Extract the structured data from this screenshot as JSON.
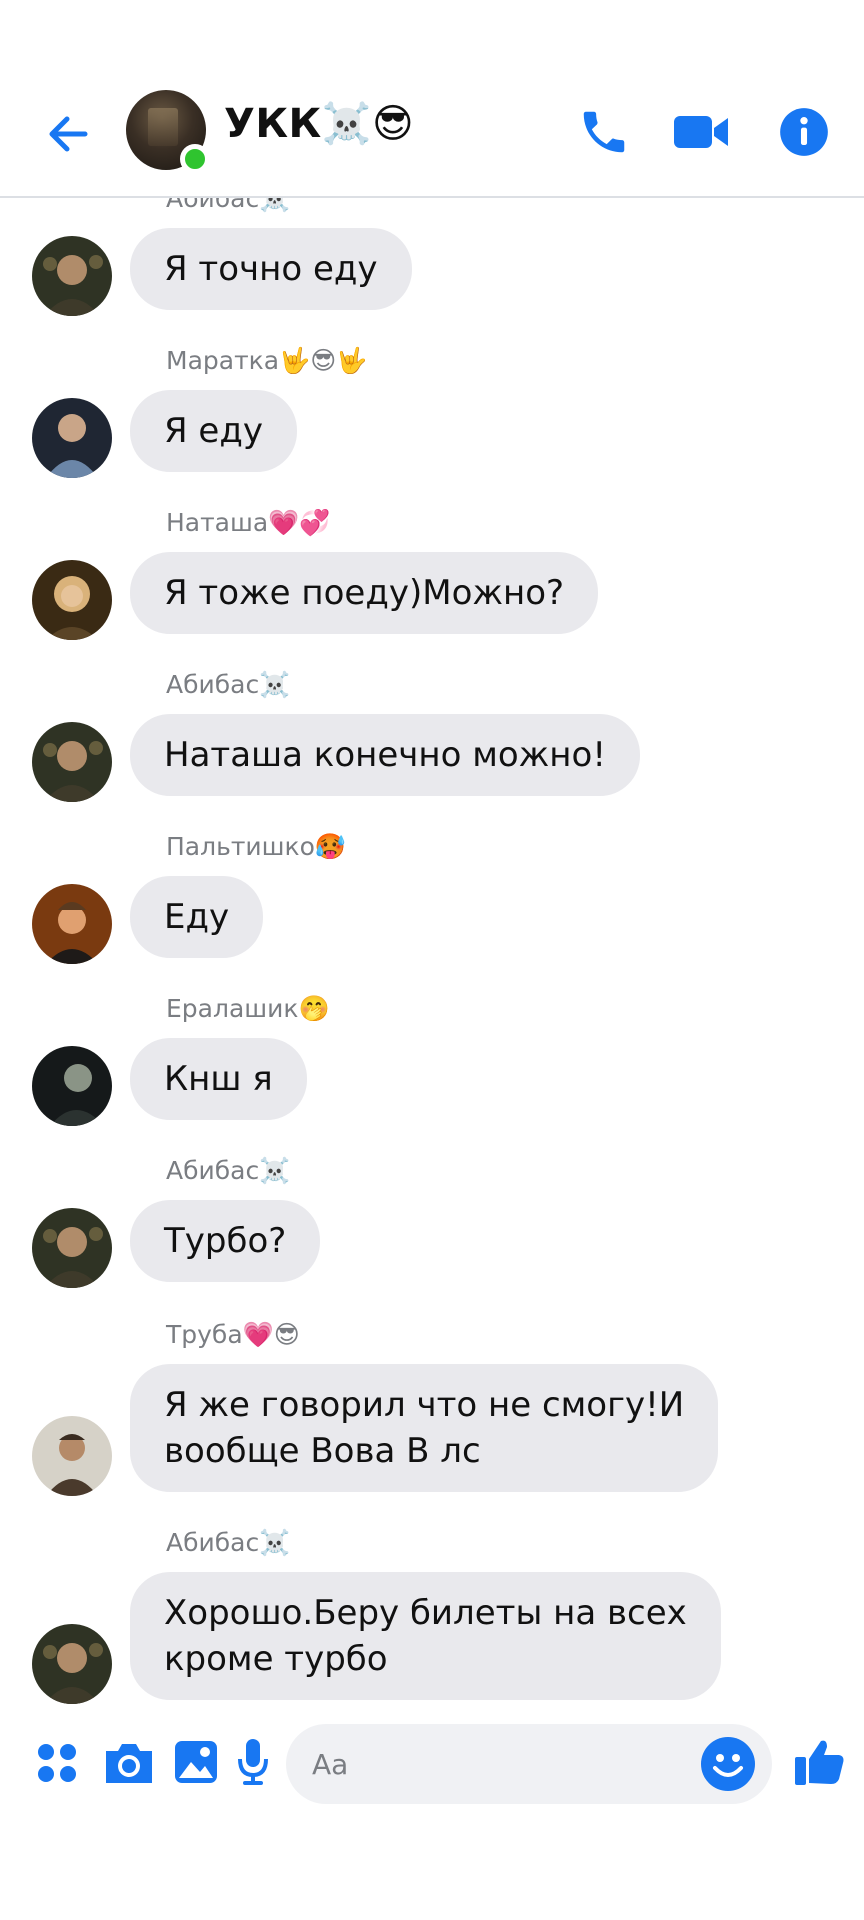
{
  "header": {
    "title": "УКК☠️😎",
    "back_icon": "arrow-left-icon",
    "call_icon": "phone-icon",
    "video_icon": "video-camera-icon",
    "info_icon": "info-icon",
    "accent_color": "#1877f2",
    "online_color": "#2fc42f"
  },
  "messages": [
    {
      "sender": "Абибас☠️",
      "text": "Я точно еду"
    },
    {
      "sender": "Маратка🤟😎🤟",
      "text": "Я еду"
    },
    {
      "sender": "Наташа💗💞",
      "text": "Я тоже поеду)Можно?"
    },
    {
      "sender": "Абибас☠️",
      "text": "Наташа конечно можно!"
    },
    {
      "sender": "Пальтишко🥵",
      "text": "Еду"
    },
    {
      "sender": "Ералашик🤭",
      "text": "Кнш я"
    },
    {
      "sender": "Абибас☠️",
      "text": "Турбо?"
    },
    {
      "sender": "Труба💗😎",
      "text": "Я же говорил что не смогу!И\nвообще Вова В лс"
    },
    {
      "sender": "Абибас☠️",
      "text": "Хорошо.Беру билеты на всех\nкроме турбо"
    }
  ],
  "composer": {
    "placeholder": "Aa",
    "menu_icon": "four-dots-menu-icon",
    "camera_icon": "camera-icon",
    "gallery_icon": "image-gallery-icon",
    "mic_icon": "microphone-icon",
    "emoji_icon": "smiley-emoji-icon",
    "like_icon": "thumbs-up-icon"
  }
}
